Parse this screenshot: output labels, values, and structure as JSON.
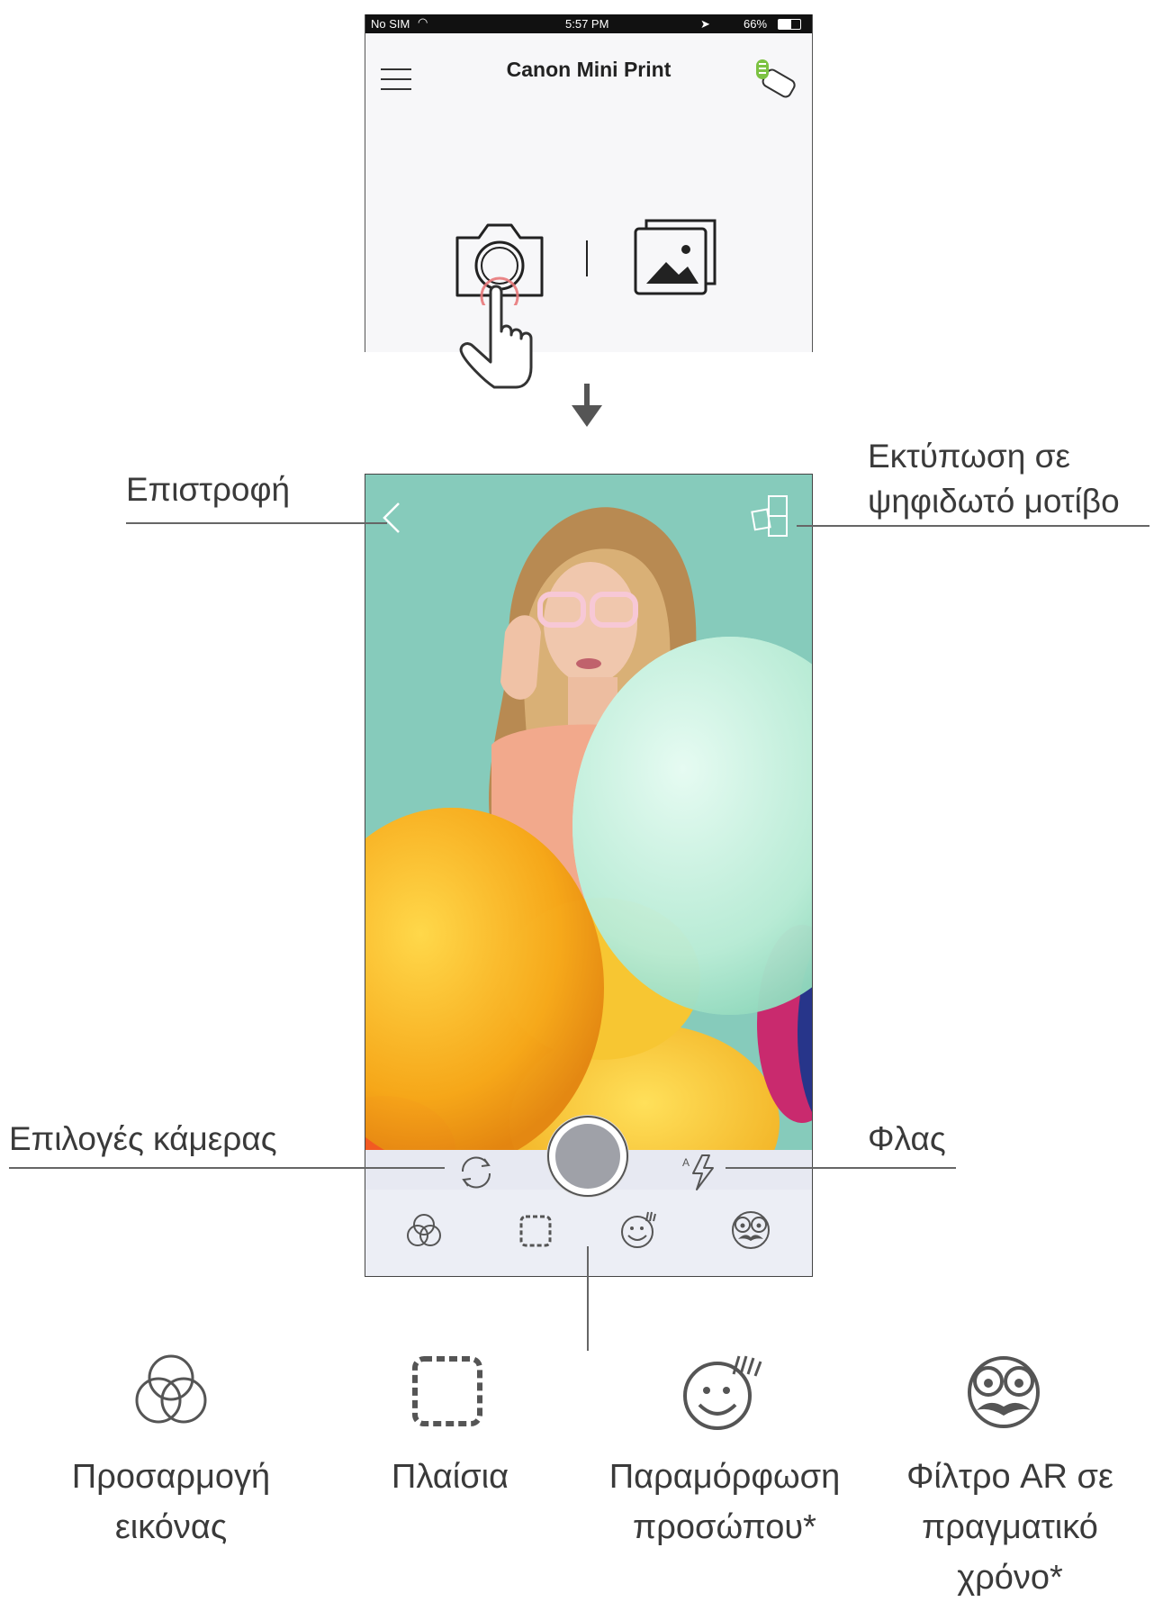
{
  "status_bar": {
    "carrier": "No SIM",
    "time": "5:57 PM",
    "battery": "66%"
  },
  "app": {
    "title": "Canon Mini Print"
  },
  "labels": {
    "back": "Επιστροφή",
    "tile_print": "Εκτύπωση σε\nψηφιδωτό μοτίβο",
    "camera_options": "Επιλογές κάμερας",
    "flash": "Φλας"
  },
  "features": [
    {
      "label": "Προσαρμογή\nεικόνας",
      "icon": "adjust-image-icon"
    },
    {
      "label": "Πλαίσια",
      "icon": "frames-icon"
    },
    {
      "label": "Παραμόρφωση\nπροσώπου*",
      "icon": "face-warp-icon"
    },
    {
      "label": "Φίλτρο AR σε\nπραγματικό\nχρόνο*",
      "icon": "ar-filter-icon"
    }
  ],
  "colors": {
    "background": "#ffffff",
    "text": "#3a3a3a",
    "photo_bg": "#8fd1c0",
    "control_bar": "#e7e9f2"
  }
}
